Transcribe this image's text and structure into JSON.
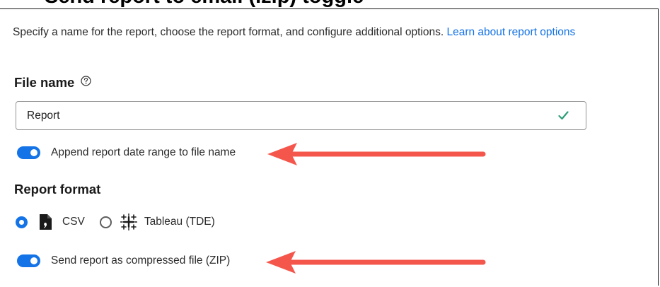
{
  "header": {
    "cut_title": "Send report to email (.zip) toggle"
  },
  "intro": {
    "text": "Specify a name for the report, choose the report format, and configure additional options. ",
    "link": "Learn about report options"
  },
  "file_name": {
    "label": "File name",
    "help_icon": "help-circle-icon",
    "value": "Report",
    "valid_icon": "checkmark-icon"
  },
  "append_toggle": {
    "label": "Append report date range to file name",
    "on": true
  },
  "report_format": {
    "label": "Report format",
    "options": [
      {
        "label": "CSV",
        "icon": "csv-file-icon",
        "selected": true
      },
      {
        "label": "Tableau (TDE)",
        "icon": "tableau-icon",
        "selected": false
      }
    ]
  },
  "zip_toggle": {
    "label": "Send report as compressed file (ZIP)",
    "on": true
  },
  "colors": {
    "accent": "#1473e6",
    "annotation_arrow": "#f5564c",
    "valid": "#2d9d78"
  }
}
